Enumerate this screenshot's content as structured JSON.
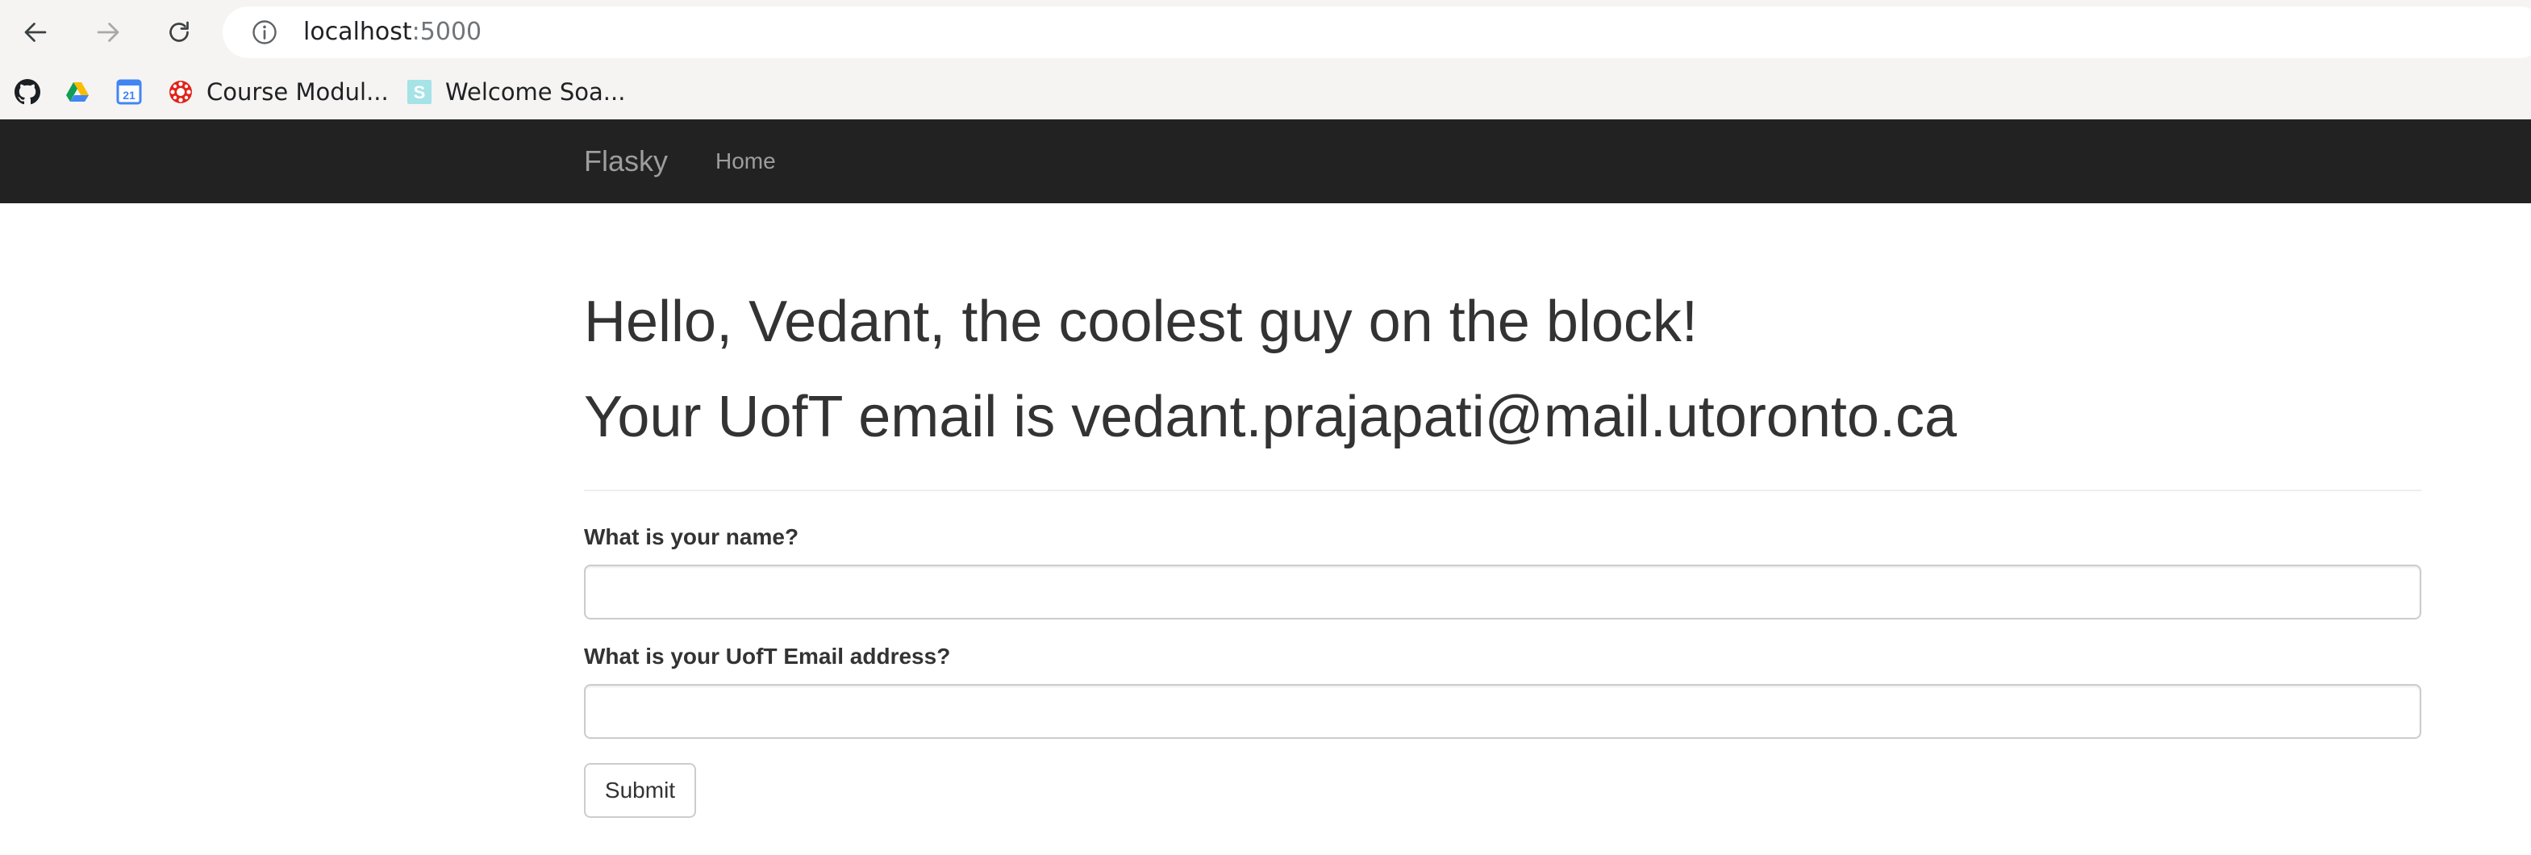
{
  "browser": {
    "url_host": "localhost",
    "url_port": ":5000",
    "bookmarks": [
      {
        "icon": "github-icon",
        "label": ""
      },
      {
        "icon": "google-drive-icon",
        "label": ""
      },
      {
        "icon": "google-calendar-icon",
        "label": "21"
      },
      {
        "icon": "quercus-icon",
        "label": "Course Modul..."
      },
      {
        "icon": "soapbox-icon",
        "label": "Welcome Soa...",
        "icon_text": "S"
      }
    ]
  },
  "navbar": {
    "brand": "Flasky",
    "links": [
      "Home"
    ]
  },
  "main": {
    "greeting": "Hello, Vedant, the coolest guy on the block!",
    "email_line": "Your UofT email is vedant.prajapati@mail.utoronto.ca",
    "form": {
      "name_label": "What is your name?",
      "name_value": "",
      "email_label": "What is your UofT Email address?",
      "email_value": "",
      "submit_label": "Submit"
    }
  },
  "colors": {
    "navbar_bg": "#222222",
    "navbar_text": "#9d9d9d",
    "heading_text": "#333333",
    "browser_chrome": "#f5f4f2"
  }
}
